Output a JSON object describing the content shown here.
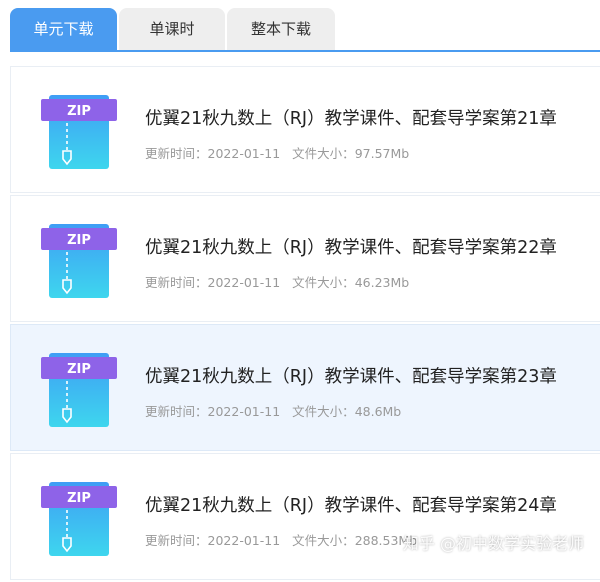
{
  "tabs": [
    {
      "label": "单元下载",
      "active": true
    },
    {
      "label": "单课时",
      "active": false
    },
    {
      "label": "整本下载",
      "active": false
    }
  ],
  "files": [
    {
      "title": "优翼21秋九数上（RJ）教学课件、配套导学案第21章",
      "time_label": "更新时间：",
      "time": "2022-01-11",
      "size_label": "文件大小：",
      "size": "97.57Mb",
      "icon": "zip-file-icon",
      "icon_text": "ZIP",
      "highlighted": false
    },
    {
      "title": "优翼21秋九数上（RJ）教学课件、配套导学案第22章",
      "time_label": "更新时间：",
      "time": "2022-01-11",
      "size_label": "文件大小：",
      "size": "46.23Mb",
      "icon": "zip-file-icon",
      "icon_text": "ZIP",
      "highlighted": false
    },
    {
      "title": "优翼21秋九数上（RJ）教学课件、配套导学案第23章",
      "time_label": "更新时间：",
      "time": "2022-01-11",
      "size_label": "文件大小：",
      "size": "48.6Mb",
      "icon": "zip-file-icon",
      "icon_text": "ZIP",
      "highlighted": true
    },
    {
      "title": "优翼21秋九数上（RJ）教学课件、配套导学案第24章",
      "time_label": "更新时间：",
      "time": "2022-01-11",
      "size_label": "文件大小：",
      "size": "288.53Mb",
      "icon": "zip-file-icon",
      "icon_text": "ZIP",
      "highlighted": false
    }
  ],
  "watermark": "知乎 @初中数学实验老师",
  "colors": {
    "accent": "#4a9bf0",
    "highlight_bg": "#eef5fe",
    "zip_band": "#8e63e8"
  }
}
